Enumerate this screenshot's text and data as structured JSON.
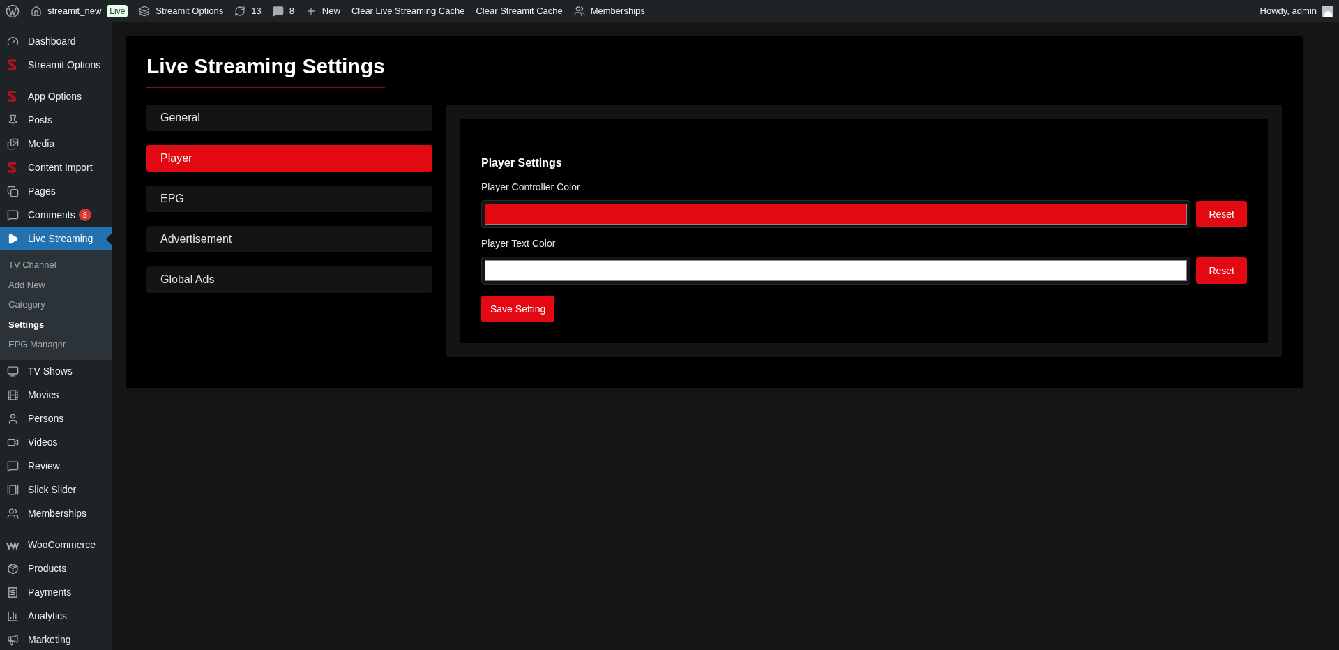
{
  "admin_bar": {
    "site": "streamit_new",
    "badge": "Live",
    "items": [
      {
        "label": "Streamit Options"
      },
      {
        "label": "13"
      },
      {
        "label": "8"
      },
      {
        "label": "New"
      },
      {
        "label": "Clear Live Streaming Cache"
      },
      {
        "label": "Clear Streamit Cache"
      },
      {
        "label": "Memberships"
      }
    ],
    "greeting": "Howdy, admin"
  },
  "sidebar": {
    "sections": [
      {
        "items": [
          {
            "label": "Dashboard",
            "selected": false
          },
          {
            "label": "Streamit Options",
            "selected": false
          }
        ]
      },
      {
        "items": [
          {
            "label": "App Options",
            "selected": false
          },
          {
            "label": "Posts",
            "selected": false
          },
          {
            "label": "Media",
            "selected": false
          },
          {
            "label": "Content Import",
            "selected": false
          },
          {
            "label": "Pages",
            "selected": false
          },
          {
            "label": "Comments",
            "selected": false,
            "badge": "8"
          },
          {
            "label": "Live Streaming",
            "selected": true,
            "children": [
              {
                "label": "TV Channel",
                "selected": false
              },
              {
                "label": "Add New",
                "selected": false
              },
              {
                "label": "Category",
                "selected": false
              },
              {
                "label": "Settings",
                "selected": true
              },
              {
                "label": "EPG Manager",
                "selected": false
              }
            ]
          },
          {
            "label": "TV Shows",
            "selected": false
          },
          {
            "label": "Movies",
            "selected": false
          },
          {
            "label": "Persons",
            "selected": false
          },
          {
            "label": "Videos",
            "selected": false
          },
          {
            "label": "Review",
            "selected": false
          },
          {
            "label": "Slick Slider",
            "selected": false
          },
          {
            "label": "Memberships",
            "selected": false
          }
        ]
      },
      {
        "items": [
          {
            "label": "WooCommerce",
            "selected": false
          },
          {
            "label": "Products",
            "selected": false
          },
          {
            "label": "Payments",
            "selected": false
          },
          {
            "label": "Analytics",
            "selected": false
          },
          {
            "label": "Marketing",
            "selected": false
          }
        ]
      }
    ]
  },
  "page": {
    "title": "Live Streaming Settings",
    "tabs": [
      {
        "label": "General",
        "selected": false
      },
      {
        "label": "Player",
        "selected": true
      },
      {
        "label": "EPG",
        "selected": false
      },
      {
        "label": "Advertisement",
        "selected": false
      },
      {
        "label": "Global Ads",
        "selected": false
      }
    ],
    "panel": {
      "heading": "Player Settings",
      "fields": [
        {
          "label": "Player Controller Color",
          "color": "#e30913",
          "button": "Reset"
        },
        {
          "label": "Player Text Color",
          "color": "#ffffff",
          "button": "Reset"
        }
      ],
      "save_button": "Save Setting"
    }
  }
}
